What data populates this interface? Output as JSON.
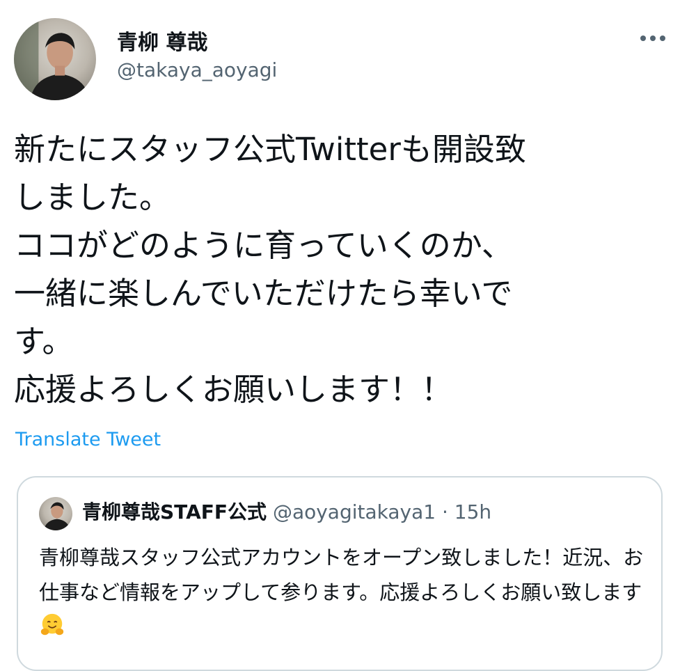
{
  "tweet": {
    "author": {
      "display_name": "青柳 尊哉",
      "handle": "@takaya_aoyagi"
    },
    "more_icon": "more-horizontal-icon",
    "text": "新たにスタッフ公式Twitterも開設致\nしました。\nココがどのように育っていくのか、\n一緒に楽しんでいただけたら幸いで\nす。\n応援よろしくお願いします！！",
    "translate_label": "Translate Tweet",
    "quoted": {
      "display_name": "青柳尊哉STAFF公式",
      "handle": "@aoyagitakaya1",
      "separator": "·",
      "time": "15h",
      "text": "青柳尊哉スタッフ公式アカウントをオープン致しました！近況、お仕事など情報をアップして参ります。応援よろしくお願い致します",
      "emoji": "hugging-face-emoji"
    }
  },
  "colors": {
    "text": "#0f1419",
    "secondary": "#536471",
    "link": "#1d9bf0",
    "border": "#cfd9de"
  }
}
